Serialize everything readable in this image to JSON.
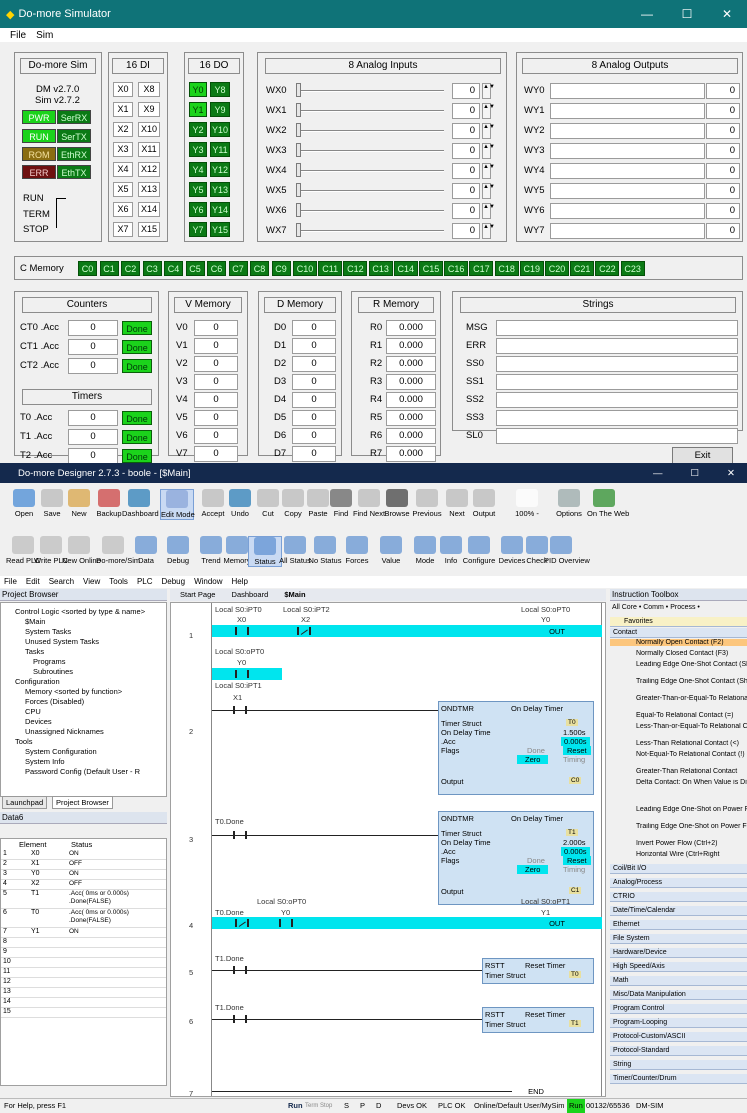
{
  "sim": {
    "title": "Do-more Simulator",
    "menu": [
      "File",
      "Sim"
    ],
    "domore": {
      "header": "Do-more Sim",
      "version": "DM v2.7.0",
      "sim_version": "Sim v2.7.2",
      "leds": [
        [
          "PWR",
          "SerRX"
        ],
        [
          "RUN",
          "SerTX"
        ],
        [
          "ROM",
          "EthRX"
        ],
        [
          "ERR",
          "EthTX"
        ]
      ],
      "run": "RUN",
      "term": "TERM",
      "stop": "STOP"
    },
    "di": {
      "header": "16 DI",
      "rows": [
        [
          "X0",
          "X8"
        ],
        [
          "X1",
          "X9"
        ],
        [
          "X2",
          "X10"
        ],
        [
          "X3",
          "X11"
        ],
        [
          "X4",
          "X12"
        ],
        [
          "X5",
          "X13"
        ],
        [
          "X6",
          "X14"
        ],
        [
          "X7",
          "X15"
        ]
      ]
    },
    "do": {
      "header": "16 DO",
      "rows": [
        [
          "Y0",
          "Y8"
        ],
        [
          "Y1",
          "Y9"
        ],
        [
          "Y2",
          "Y10"
        ],
        [
          "Y3",
          "Y11"
        ],
        [
          "Y4",
          "Y12"
        ],
        [
          "Y5",
          "Y13"
        ],
        [
          "Y6",
          "Y14"
        ],
        [
          "Y7",
          "Y15"
        ]
      ]
    },
    "ai": {
      "header": "8 Analog Inputs",
      "names": [
        "WX0",
        "WX1",
        "WX2",
        "WX3",
        "WX4",
        "WX5",
        "WX6",
        "WX7"
      ],
      "values": [
        "0",
        "0",
        "0",
        "0",
        "0",
        "0",
        "0",
        "0"
      ]
    },
    "ao": {
      "header": "8 Analog Outputs",
      "names": [
        "WY0",
        "WY1",
        "WY2",
        "WY3",
        "WY4",
        "WY5",
        "WY6",
        "WY7"
      ],
      "values": [
        "0",
        "0",
        "0",
        "0",
        "0",
        "0",
        "0",
        "0"
      ]
    },
    "cmem": {
      "label": "C Memory",
      "items": [
        "C0",
        "C1",
        "C2",
        "C3",
        "C4",
        "C5",
        "C6",
        "C7",
        "C8",
        "C9",
        "C10",
        "C11",
        "C12",
        "C13",
        "C14",
        "C15",
        "C16",
        "C17",
        "C18",
        "C19",
        "C20",
        "C21",
        "C22",
        "C23"
      ]
    },
    "counters": {
      "header": "Counters",
      "rows": [
        {
          "name": "CT0 .Acc",
          "value": "0",
          "status": "Done"
        },
        {
          "name": "CT1 .Acc",
          "value": "0",
          "status": "Done"
        },
        {
          "name": "CT2 .Acc",
          "value": "0",
          "status": "Done"
        }
      ]
    },
    "timers": {
      "header": "Timers",
      "rows": [
        {
          "name": "T0 .Acc",
          "value": "0",
          "status": "Done"
        },
        {
          "name": "T1 .Acc",
          "value": "0",
          "status": "Done"
        },
        {
          "name": "T2 .Acc",
          "value": "0",
          "status": "Done"
        }
      ]
    },
    "vmem": {
      "header": "V Memory",
      "names": [
        "V0",
        "V1",
        "V2",
        "V3",
        "V4",
        "V5",
        "V6",
        "V7"
      ],
      "values": [
        "0",
        "0",
        "0",
        "0",
        "0",
        "0",
        "0",
        "0"
      ]
    },
    "dmem": {
      "header": "D Memory",
      "names": [
        "D0",
        "D1",
        "D2",
        "D3",
        "D4",
        "D5",
        "D6",
        "D7"
      ],
      "values": [
        "0",
        "0",
        "0",
        "0",
        "0",
        "0",
        "0",
        "0"
      ]
    },
    "rmem": {
      "header": "R Memory",
      "names": [
        "R0",
        "R1",
        "R2",
        "R3",
        "R4",
        "R5",
        "R6",
        "R7"
      ],
      "values": [
        "0.000",
        "0.000",
        "0.000",
        "0.000",
        "0.000",
        "0.000",
        "0.000",
        "0.000"
      ]
    },
    "strings": {
      "header": "Strings",
      "names": [
        "MSG",
        "ERR",
        "SS0",
        "SS1",
        "SS2",
        "SS3",
        "SL0"
      ]
    },
    "exit": "Exit"
  },
  "designer": {
    "title": "Do-more Designer 2.7.3 - boole - [$Main]",
    "toolbar1": [
      "Open",
      "Save",
      "New",
      "Backup",
      "Dashboard",
      "Edit Mode",
      "Accept",
      "Undo",
      "Cut",
      "Copy",
      "Paste",
      "Find",
      "Find Next",
      "Browse",
      "Previous",
      "Next",
      "Output",
      "100% -",
      "Options",
      "On The Web"
    ],
    "toolbar2": [
      "Read PLC",
      "Write PLC",
      "New Online",
      "Do-more/Sim",
      "Data",
      "Debug",
      "Trend",
      "Memory",
      "Status",
      "All Status",
      "No Status",
      "Forces",
      "Value",
      "Mode",
      "Info",
      "Configure",
      "Devices",
      "Check",
      "PID Overview"
    ],
    "menu": [
      "File",
      "Edit",
      "Search",
      "View",
      "Tools",
      "PLC",
      "Debug",
      "Window",
      "Help"
    ],
    "project_browser": {
      "title": "Project Browser",
      "tree": [
        "Control Logic <sorted by type & name>",
        "$Main",
        "System Tasks",
        "Unused System Tasks",
        "Tasks",
        "Programs",
        "Subroutines",
        "Configuration",
        "Memory <sorted by function>",
        "Forces (Disabled)",
        "CPU",
        "Devices",
        "Unassigned Nicknames",
        "Tools",
        "System Configuration",
        "System Info",
        "Password Config (Default User - R"
      ],
      "tabs": [
        "Launchpad",
        "Project Browser"
      ]
    },
    "data6": {
      "title": "Data6",
      "cols": [
        "Element",
        "Status"
      ],
      "rows": [
        [
          "1",
          "X0",
          "ON"
        ],
        [
          "2",
          "X1",
          "OFF"
        ],
        [
          "3",
          "Y0",
          "ON"
        ],
        [
          "4",
          "X2",
          "OFF"
        ],
        [
          "5",
          "T1",
          ".Acc(   0ms or  0.000s) .Done(FALSE)"
        ],
        [
          "6",
          "T0",
          ".Acc(   0ms or  0.000s) .Done(FALSE)"
        ],
        [
          "7",
          "Y1",
          "ON"
        ],
        [
          "8",
          "",
          ""
        ],
        [
          "9",
          "",
          ""
        ],
        [
          "10",
          "",
          ""
        ],
        [
          "11",
          "",
          ""
        ],
        [
          "12",
          "",
          ""
        ],
        [
          "13",
          "",
          ""
        ],
        [
          "14",
          "",
          ""
        ],
        [
          "15",
          "",
          ""
        ]
      ]
    },
    "tabs": [
      "Start Page",
      "Dashboard",
      "$Main"
    ],
    "ladder": {
      "r1": {
        "num": "1",
        "c1": "X0",
        "c2": "X2",
        "coil": "Y0",
        "coil_label": "OUT",
        "nick1": "Local S0:iPT0",
        "nick2": "Local S0:iPT2",
        "nick3": "Local S0:oPT0",
        "par": "Y0",
        "par_nick": "Local S0:oPT0"
      },
      "r2": {
        "num": "2",
        "c1": "X1",
        "nick": "Local S0:iPT1",
        "blk": "ONDTMR",
        "blk_title": "On Delay Timer",
        "ts": "Timer Struct",
        "ts_val": "T0",
        "odt": "On Delay Time",
        "odt_val": "1.500s",
        "acc": ".Acc",
        "acc_val": "0.000s",
        "flags": "Flags",
        "done": "Done",
        "reset": "Reset",
        "zero": "Zero",
        "timing": "Timing",
        "output": "Output",
        "out_val": "C0"
      },
      "r3": {
        "num": "3",
        "c1": "T0.Done",
        "blk": "ONDTMR",
        "blk_title": "On Delay Timer",
        "ts": "Timer Struct",
        "ts_val": "T1",
        "odt": "On Delay Time",
        "odt_val": "2.000s",
        "acc": ".Acc",
        "acc_val": "0.000s",
        "flags": "Flags",
        "done": "Done",
        "reset": "Reset",
        "zero": "Zero",
        "timing": "Timing",
        "output": "Output",
        "out_val": "C1"
      },
      "r4": {
        "num": "4",
        "c1": "T0.Done",
        "c2": "Y0",
        "coil": "Y1",
        "coil_label": "OUT",
        "nick1": "Local S0:oPT0",
        "nick2": "Local S0:oPT1"
      },
      "r5": {
        "num": "5",
        "c1": "T1.Done",
        "blk": "RSTT",
        "blk_title": "Reset Timer",
        "ts": "Timer Struct",
        "ts_val": "T0"
      },
      "r6": {
        "num": "6",
        "c1": "T1.Done",
        "blk": "RSTT",
        "blk_title": "Reset Timer",
        "ts": "Timer Struct",
        "ts_val": "T1"
      },
      "r7": {
        "num": "7",
        "end": "END"
      }
    },
    "toolbox": {
      "title": "Instruction Toolbox",
      "filter": "All Core • Comm • Process •",
      "favorites": "Favorites",
      "contact": "Contact",
      "items": [
        "Normally Open Contact (F2)",
        "Normally Closed Contact (F3)",
        "Leading Edge One-Shot Contact (Shift+F2)",
        "Trailing Edge One-Shot Contact (Shift+F3)",
        "Greater-Than-or-Equal-To Relational Contact (>)",
        "Equal-To Relational Contact (=)",
        "Less-Than-or-Equal-To Relational Contact",
        "Less-Than Relational Contact (<)",
        "Not-Equal-To Relational Contact (!)",
        "Greater-Than Relational Contact",
        "Delta Contact: On When Value is Different from Previous Scan (Ctrl+1)",
        "Leading Edge One-Shot on Power Flow (Ctrl+F2)",
        "Trailing Edge One-Shot on Power Flow (Ctrl+F3)",
        "Invert Power Flow (Ctrl+2)",
        "Horizontal Wire (Ctrl+Right"
      ],
      "cats": [
        "Coil/Bit I/O",
        "Analog/Process",
        "CTRIO",
        "Date/Time/Calendar",
        "Ethernet",
        "File System",
        "Hardware/Device",
        "High Speed/Axis",
        "Math",
        "Misc/Data Manipulation",
        "Program Control",
        "Program-Looping",
        "Protocol-Custom/ASCII",
        "Protocol-Standard",
        "String",
        "Timer/Counter/Drum"
      ]
    },
    "status": {
      "help": "For Help, press F1",
      "run": "Run",
      "term": "Term",
      "stop": "Stop",
      "s": "S",
      "p": "P",
      "d": "D",
      "devs": "Devs OK",
      "plc": "PLC OK",
      "online": "Online/Default User/MySim",
      "runb": "Run",
      "mem": "00132/65536",
      "mode": "DM-SIM"
    }
  }
}
